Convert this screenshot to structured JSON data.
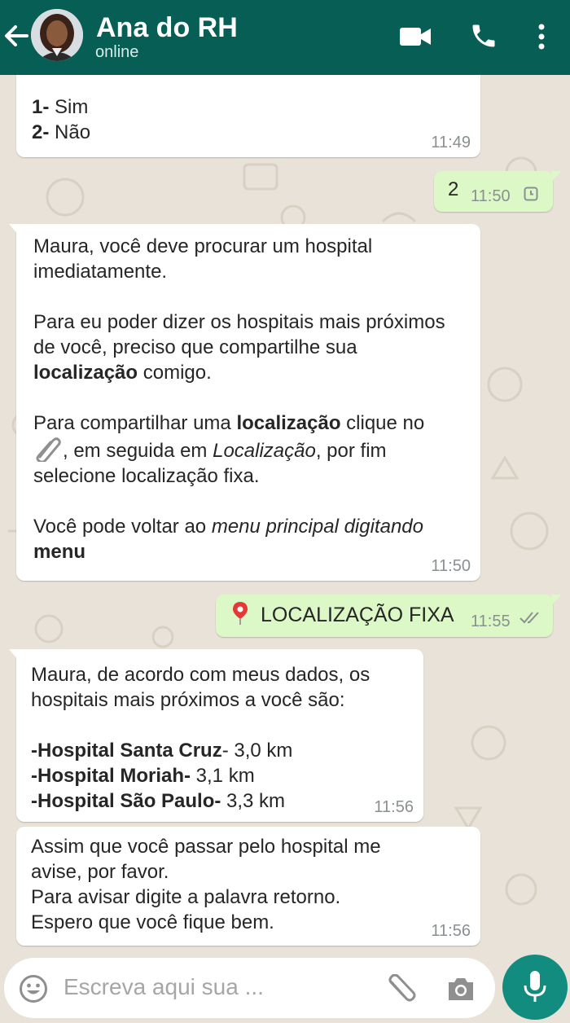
{
  "header": {
    "contact_name": "Ana do RH",
    "status": "online",
    "color": "#075e54",
    "icons": [
      "back-arrow-icon",
      "video-call-icon",
      "phone-icon",
      "more-vert-icon"
    ]
  },
  "messages": [
    {
      "direction": "incoming",
      "lines": [
        "1- Sim",
        "2- Não"
      ],
      "time": "11:49"
    },
    {
      "direction": "outgoing",
      "text": "2",
      "time": "11:50",
      "status_icon": "clock-pending-icon"
    },
    {
      "direction": "incoming",
      "p1": "Maura, você deve procurar um hospital imediatamente.",
      "p2_a": "Para eu poder dizer os hospitais mais próximos de você, preciso que compartilhe sua ",
      "p2_b": "localização",
      "p2_c": " comigo.",
      "p3_a": "Para compartilhar uma ",
      "p3_b": "localização",
      "p3_c": " clique no ",
      "p3_d": ", em seguida em ",
      "p3_e": "Localização",
      "p3_f": ", por fim selecione localização fixa.",
      "p4_a": "Você pode voltar ao ",
      "p4_b": "menu principal digitando",
      "p4_c": "menu",
      "time": "11:50"
    },
    {
      "direction": "outgoing",
      "text": "LOCALIZAÇÃO FIXA",
      "time": "11:55",
      "status_icon": "double-check-icon"
    },
    {
      "direction": "incoming",
      "intro": "Maura, de acordo com meus dados, os hospitais mais próximos a você são:",
      "hospitals": [
        {
          "name": "-Hospital Santa Cruz",
          "sep": "-",
          "distance": " 3,0 km"
        },
        {
          "name": "-Hospital Moriah-",
          "sep": "",
          "distance": " 3,1 km"
        },
        {
          "name": "-Hospital São Paulo-",
          "sep": "",
          "distance": " 3,3 km"
        }
      ],
      "time": "11:56"
    },
    {
      "direction": "incoming",
      "lines": [
        "Assim que você passar pelo hospital me",
        "avise, por favor.",
        "Para avisar digite a palavra retorno.",
        "Espero que você fique bem."
      ],
      "time": "11:56"
    }
  ],
  "composer": {
    "placeholder": "Escreva aqui sua ...",
    "icons": [
      "emoji-icon",
      "attach-icon",
      "camera-icon",
      "mic-icon"
    ],
    "mic_color": "#128c7e"
  }
}
